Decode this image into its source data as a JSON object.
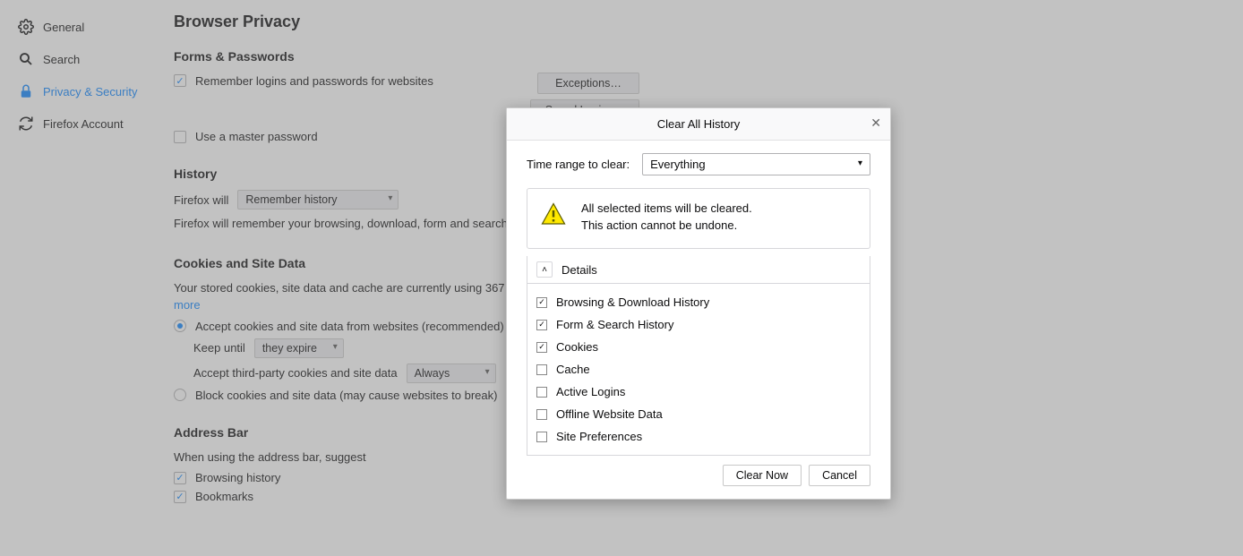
{
  "sidebar": {
    "items": [
      {
        "label": "General"
      },
      {
        "label": "Search"
      },
      {
        "label": "Privacy & Security"
      },
      {
        "label": "Firefox Account"
      }
    ]
  },
  "page": {
    "title": "Browser Privacy"
  },
  "forms": {
    "heading": "Forms & Passwords",
    "remember": "Remember logins and passwords for websites",
    "exceptions_btn": "Exceptions…",
    "saved_logins_btn": "Saved Logins…",
    "master": "Use a master password"
  },
  "history": {
    "heading": "History",
    "prefix": "Firefox will",
    "mode": "Remember history",
    "desc": "Firefox will remember your browsing, download, form and search history."
  },
  "cookies": {
    "heading": "Cookies and Site Data",
    "desc": "Your stored cookies, site data and cache are currently using 367 MB of disk space.",
    "learn_more": "Learn more",
    "accept": "Accept cookies and site data from websites (recommended)",
    "keep_until_label": "Keep until",
    "keep_until_value": "they expire",
    "third_party_label": "Accept third-party cookies and site data",
    "third_party_value": "Always",
    "block": "Block cookies and site data (may cause websites to break)"
  },
  "addressbar": {
    "heading": "Address Bar",
    "desc": "When using the address bar, suggest",
    "opt1": "Browsing history",
    "opt2": "Bookmarks"
  },
  "dialog": {
    "title": "Clear All History",
    "time_label": "Time range to clear:",
    "time_value": "Everything",
    "warn1": "All selected items will be cleared.",
    "warn2": "This action cannot be undone.",
    "details": "Details",
    "items": [
      {
        "label": "Browsing & Download History",
        "checked": true
      },
      {
        "label": "Form & Search History",
        "checked": true
      },
      {
        "label": "Cookies",
        "checked": true
      },
      {
        "label": "Cache",
        "checked": false
      },
      {
        "label": "Active Logins",
        "checked": false
      },
      {
        "label": "Offline Website Data",
        "checked": false
      },
      {
        "label": "Site Preferences",
        "checked": false
      }
    ],
    "clear_btn": "Clear Now",
    "cancel_btn": "Cancel"
  }
}
